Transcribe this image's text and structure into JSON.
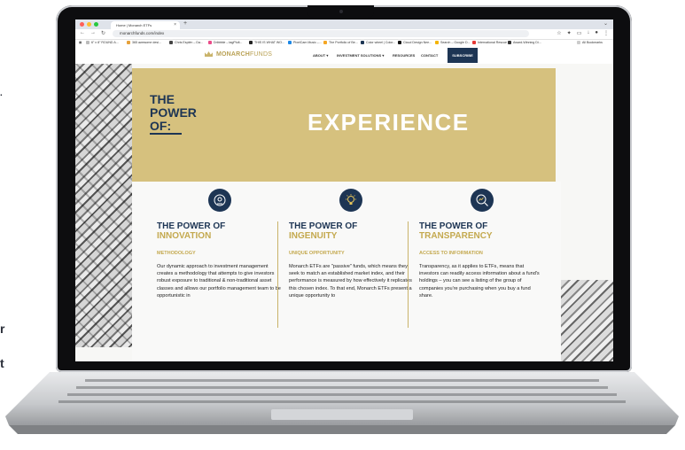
{
  "page_edge": {
    "r": "r",
    "t": "t"
  },
  "browser": {
    "tab_title": "Home | Monarch ETFs",
    "tab_close": "×",
    "new_tab": "+",
    "url": "monarchfunds.com/index",
    "bookmarks": [
      "6\" x 8\" ROUND A...",
      "365 awesome desi...",
      "Chris Esplén – Da...",
      "Dribbble – tagPlufi...",
      "THIS IS WHAT WO...",
      "PixelCam Music –...",
      "The Portfolio of Be...",
      "Color wheel | Color...",
      "Cloud Design Nee...",
      "Search – Google D...",
      "International Rescue",
      "Award-Winning Di..."
    ],
    "all_bookmarks": "All Bookmarks",
    "colors": {
      "chrome": "#dfe3ea",
      "red": "#ff5f57",
      "yellow": "#febc2e",
      "green": "#28c840"
    }
  },
  "site": {
    "logo_bold": "MONARCH",
    "logo_light": "FUNDS",
    "nav": [
      "ABOUT ▾",
      "INVESTMENT SOLUTIONS ▾",
      "RESOURCES",
      "CONTACT"
    ],
    "subscribe": "SUBSCRIBE",
    "hero": {
      "line1": "THE",
      "line2": "POWER",
      "line3": "OF:",
      "big": "EXPERIENCE"
    },
    "colors": {
      "navy": "#1d3554",
      "gold": "#d6c17e",
      "gold_text": "#c4a94f"
    },
    "features": [
      {
        "icon": "head-gear-icon",
        "title1": "THE POWER OF",
        "title2": "INNOVATION",
        "subtitle": "METHODOLOGY",
        "body": "Our dynamic approach to investment management creates a methodology that attempts to give investors robust exposure to traditional & non-traditional asset classes and allows our portfolio management team to be opportunistic in"
      },
      {
        "icon": "lightbulb-icon",
        "title1": "THE POWER OF",
        "title2": "INGENUITY",
        "subtitle": "UNIQUE OPPORTUNITY",
        "body": "Monarch ETFs are \"passive\" funds, which means they seek to match an established market index, and their performance is measured by how effectively it replicates this chosen index. To that end, Monarch ETFs present a unique opportunity to"
      },
      {
        "icon": "magnifier-chart-icon",
        "title1": "THE POWER OF",
        "title2": "TRANSPARENCY",
        "subtitle": "ACCESS TO INFORMATION",
        "body": "Transparency, as it applies to ETFs, means that investors can readily access information about a fund's holdings – you can see a listing of the group of companies you're purchasing when you buy a fund share."
      }
    ]
  }
}
